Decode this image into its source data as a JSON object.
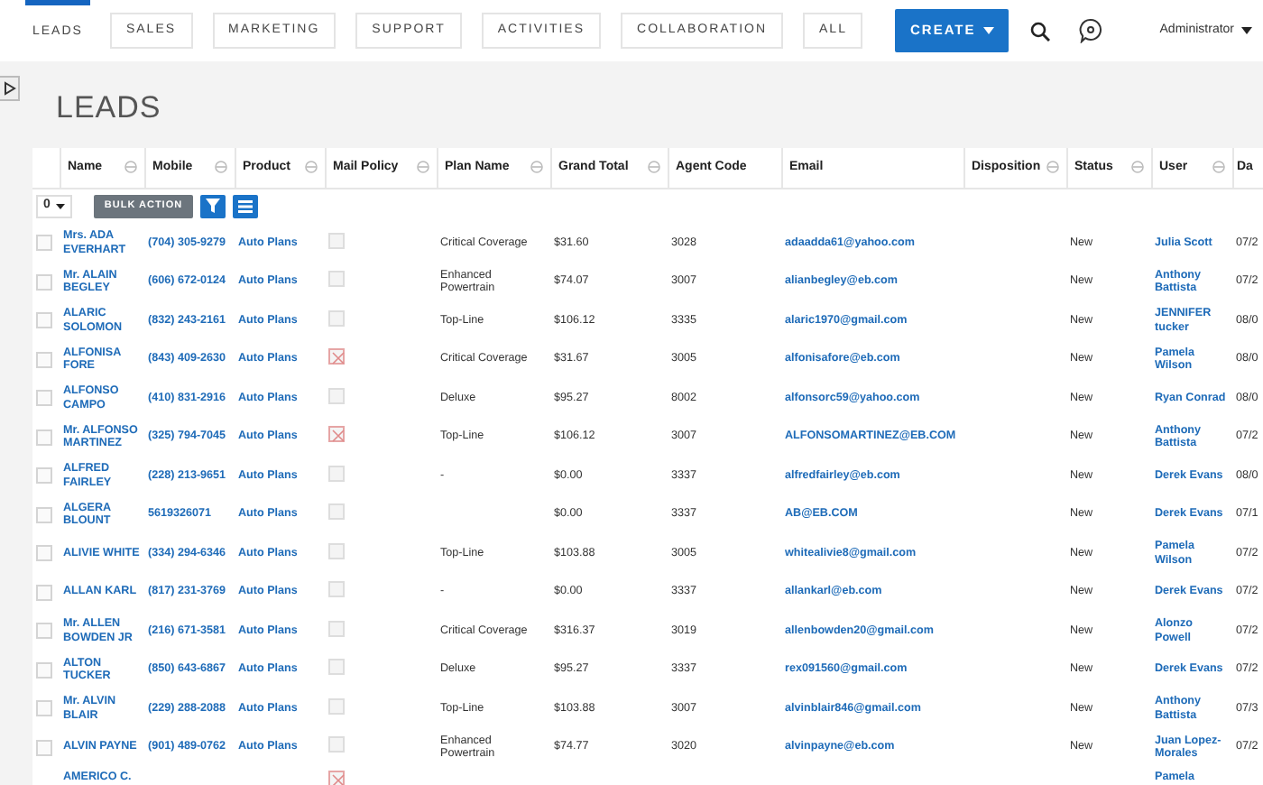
{
  "nav": {
    "tabs": [
      {
        "label": "LEADS",
        "selected": true
      },
      {
        "label": "SALES",
        "selected": false
      },
      {
        "label": "MARKETING",
        "selected": false
      },
      {
        "label": "SUPPORT",
        "selected": false
      },
      {
        "label": "ACTIVITIES",
        "selected": false
      },
      {
        "label": "COLLABORATION",
        "selected": false
      },
      {
        "label": "ALL",
        "selected": false
      }
    ],
    "create_button": "CREATE",
    "user_menu": "Administrator"
  },
  "page_title": "LEADS",
  "table": {
    "columns": [
      {
        "label": "Name",
        "sortable": true
      },
      {
        "label": "Mobile",
        "sortable": true
      },
      {
        "label": "Product",
        "sortable": true
      },
      {
        "label": "Mail Policy",
        "sortable": true
      },
      {
        "label": "Plan Name",
        "sortable": true
      },
      {
        "label": "Grand Total",
        "sortable": true
      },
      {
        "label": "Agent Code",
        "sortable": false
      },
      {
        "label": "Email",
        "sortable": false
      },
      {
        "label": "Disposition",
        "sortable": true
      },
      {
        "label": "Status",
        "sortable": true
      },
      {
        "label": "User",
        "sortable": true
      },
      {
        "label": "Da",
        "sortable": false
      }
    ],
    "toolbar": {
      "select_all": "0",
      "bulk_action": "BULK ACTION"
    },
    "rows": [
      {
        "checked": false,
        "name": "Mrs. ADA EVERHART",
        "mobile": "(704) 305-9279",
        "product": "Auto Plans",
        "mail_policy": false,
        "plan_name": "Critical Coverage",
        "grand_total": "$31.60",
        "agent_code": "3028",
        "email": "adaadda61@yahoo.com",
        "status": "New",
        "user": "Julia Scott",
        "column_12": "07/2"
      },
      {
        "checked": false,
        "name": "Mr. ALAIN BEGLEY",
        "mobile": "(606) 672-0124",
        "product": "Auto Plans",
        "mail_policy": false,
        "plan_name": "Enhanced Powertrain",
        "grand_total": "$74.07",
        "agent_code": "3007",
        "email": "alianbegley@eb.com",
        "status": "New",
        "user": "Anthony Battista",
        "column_12": "07/2"
      },
      {
        "checked": false,
        "name": "ALARIC SOLOMON",
        "mobile": "(832) 243-2161",
        "product": "Auto Plans",
        "mail_policy": false,
        "plan_name": "Top-Line",
        "grand_total": "$106.12",
        "agent_code": "3335",
        "email": "alaric1970@gmail.com",
        "status": "New",
        "user": "JENNIFER tucker",
        "column_12": "08/0"
      },
      {
        "checked": false,
        "name": "ALFONISA FORE",
        "mobile": "(843) 409-2630",
        "product": "Auto Plans",
        "mail_policy": true,
        "plan_name": "Critical Coverage",
        "grand_total": "$31.67",
        "agent_code": "3005",
        "email": "alfonisafore@eb.com",
        "status": "New",
        "user": "Pamela Wilson",
        "column_12": "08/0"
      },
      {
        "checked": false,
        "name": "ALFONSO CAMPO",
        "mobile": "(410) 831-2916",
        "product": "Auto Plans",
        "mail_policy": false,
        "plan_name": "Deluxe",
        "grand_total": "$95.27",
        "agent_code": "8002",
        "email": "alfonsorc59@yahoo.com",
        "status": "New",
        "user": "Ryan Conrad",
        "column_12": "08/0"
      },
      {
        "checked": false,
        "name": "Mr. ALFONSO MARTINEZ",
        "mobile": "(325) 794-7045",
        "product": "Auto Plans",
        "mail_policy": true,
        "plan_name": "Top-Line",
        "grand_total": "$106.12",
        "agent_code": "3007",
        "email": "ALFONSOMARTINEZ@EB.COM",
        "status": "New",
        "user": "Anthony Battista",
        "column_12": "07/2"
      },
      {
        "checked": false,
        "name": "ALFRED FAIRLEY",
        "mobile": "(228) 213-9651",
        "product": "Auto Plans",
        "mail_policy": false,
        "plan_name": "-",
        "grand_total": "$0.00",
        "agent_code": "3337",
        "email": "alfredfairley@eb.com",
        "status": "New",
        "user": "Derek Evans",
        "column_12": "08/0"
      },
      {
        "checked": false,
        "name": "ALGERA BLOUNT",
        "mobile": "5619326071",
        "product": "Auto Plans",
        "mail_policy": false,
        "grand_total": "$0.00",
        "agent_code": "3337",
        "email": "AB@EB.COM",
        "status": "New",
        "user": "Derek Evans",
        "column_12": "07/1"
      },
      {
        "checked": false,
        "name": "ALIVIE WHITE",
        "mobile": "(334) 294-6346",
        "product": "Auto Plans",
        "mail_policy": false,
        "plan_name": "Top-Line",
        "grand_total": "$103.88",
        "agent_code": "3005",
        "email": "whitealivie8@gmail.com",
        "status": "New",
        "user": "Pamela Wilson",
        "column_12": "07/2"
      },
      {
        "checked": false,
        "name": "ALLAN KARL",
        "mobile": "(817) 231-3769",
        "product": "Auto Plans",
        "mail_policy": false,
        "plan_name": "-",
        "grand_total": "$0.00",
        "agent_code": "3337",
        "email": "allankarl@eb.com",
        "status": "New",
        "user": "Derek Evans",
        "column_12": "07/2"
      },
      {
        "checked": false,
        "name": "Mr. ALLEN BOWDEN JR",
        "mobile": "(216) 671-3581",
        "product": "Auto Plans",
        "mail_policy": false,
        "plan_name": "Critical Coverage",
        "grand_total": "$316.37",
        "agent_code": "3019",
        "email": "allenbowden20@gmail.com",
        "status": "New",
        "user": "Alonzo Powell",
        "column_12": "07/2"
      },
      {
        "checked": false,
        "name": "ALTON TUCKER",
        "mobile": "(850) 643-6867",
        "product": "Auto Plans",
        "mail_policy": false,
        "plan_name": "Deluxe",
        "grand_total": "$95.27",
        "agent_code": "3337",
        "email": "rex091560@gmail.com",
        "status": "New",
        "user": "Derek Evans",
        "column_12": "07/2"
      },
      {
        "checked": false,
        "name": "Mr. ALVIN BLAIR",
        "mobile": "(229) 288-2088",
        "product": "Auto Plans",
        "mail_policy": false,
        "plan_name": "Top-Line",
        "grand_total": "$103.88",
        "agent_code": "3007",
        "email": "alvinblair846@gmail.com",
        "status": "New",
        "user": "Anthony Battista",
        "column_12": "07/3"
      },
      {
        "checked": false,
        "name": "ALVIN PAYNE",
        "mobile": "(901) 489-0762",
        "product": "Auto Plans",
        "mail_policy": false,
        "plan_name": "Enhanced Powertrain",
        "grand_total": "$74.77",
        "agent_code": "3020",
        "email": "alvinpayne@eb.com",
        "status": "New",
        "user": "Juan Lopez-Morales",
        "column_12": "07/2"
      },
      {
        "name": "AMERICO C.",
        "mail_policy": true,
        "user": "Pamela"
      }
    ]
  }
}
